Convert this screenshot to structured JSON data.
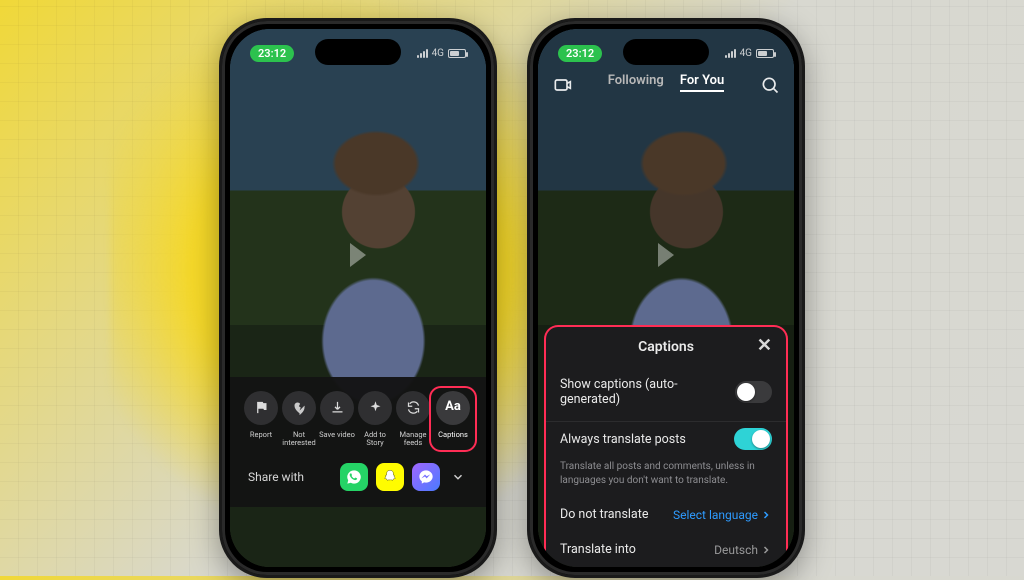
{
  "status": {
    "time": "23:12",
    "network": "4G"
  },
  "tabs": {
    "following": "Following",
    "for_you": "For You"
  },
  "left": {
    "actions": [
      {
        "key": "report",
        "label": "Report"
      },
      {
        "key": "not_interested",
        "label": "Not interested"
      },
      {
        "key": "save_video",
        "label": "Save video"
      },
      {
        "key": "add_to_story",
        "label": "Add to Story"
      },
      {
        "key": "manage_feeds",
        "label": "Manage feeds"
      },
      {
        "key": "captions",
        "label": "Captions",
        "icon_text": "Aa"
      }
    ],
    "share_with": "Share with"
  },
  "right": {
    "panel_title": "Captions",
    "show_captions": {
      "label": "Show captions (auto-generated)",
      "on": false
    },
    "always_translate": {
      "label": "Always translate posts",
      "sub": "Translate all posts and comments, unless in languages you don't want to translate.",
      "on": true
    },
    "do_not_translate": {
      "label": "Do not translate",
      "value": "Select language"
    },
    "translate_into": {
      "label": "Translate into",
      "value": "Deutsch"
    }
  }
}
